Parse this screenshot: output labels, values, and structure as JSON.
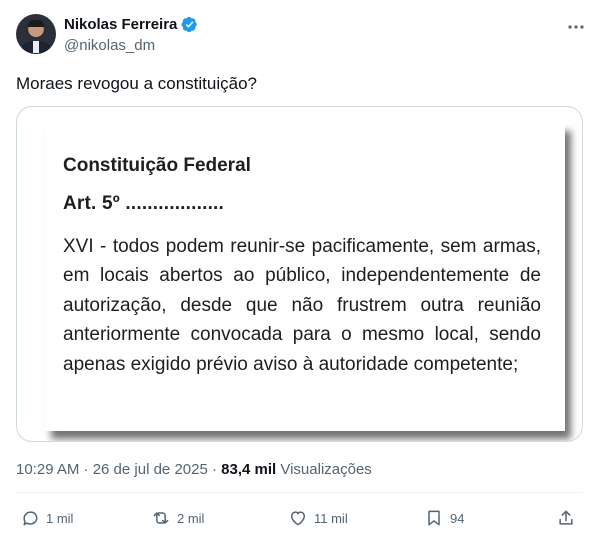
{
  "author": {
    "display_name": "Nikolas Ferreira",
    "handle": "@nikolas_dm",
    "verified": true
  },
  "tweet": {
    "text": "Moraes revogou a constituição?"
  },
  "media": {
    "title": "Constituição Federal",
    "article": "Art. 5º ..................",
    "body": "XVI - todos podem reunir-se pacificamente, sem armas, em locais abertos ao público, independentemente de autorização, desde que não frustrem outra reunião anteriormente convocada para o mesmo local, sendo apenas exigido prévio aviso à autoridade competente;"
  },
  "meta": {
    "time_date": "10:29 AM · 26 de jul de 2025 · ",
    "views_count": "83,4 mil",
    "views_label": " Visualizações"
  },
  "actions": {
    "replies": "1 mil",
    "reposts": "2 mil",
    "likes": "11 mil",
    "bookmarks": "94"
  },
  "icons": [
    "verified-badge-icon",
    "more-options-icon",
    "reply-icon",
    "repost-icon",
    "like-icon",
    "bookmark-icon",
    "share-icon"
  ],
  "colors": {
    "verified": "#1d9bf0",
    "secondary_text": "#536471",
    "primary_text": "#0f1419",
    "border": "#cfd9de"
  }
}
